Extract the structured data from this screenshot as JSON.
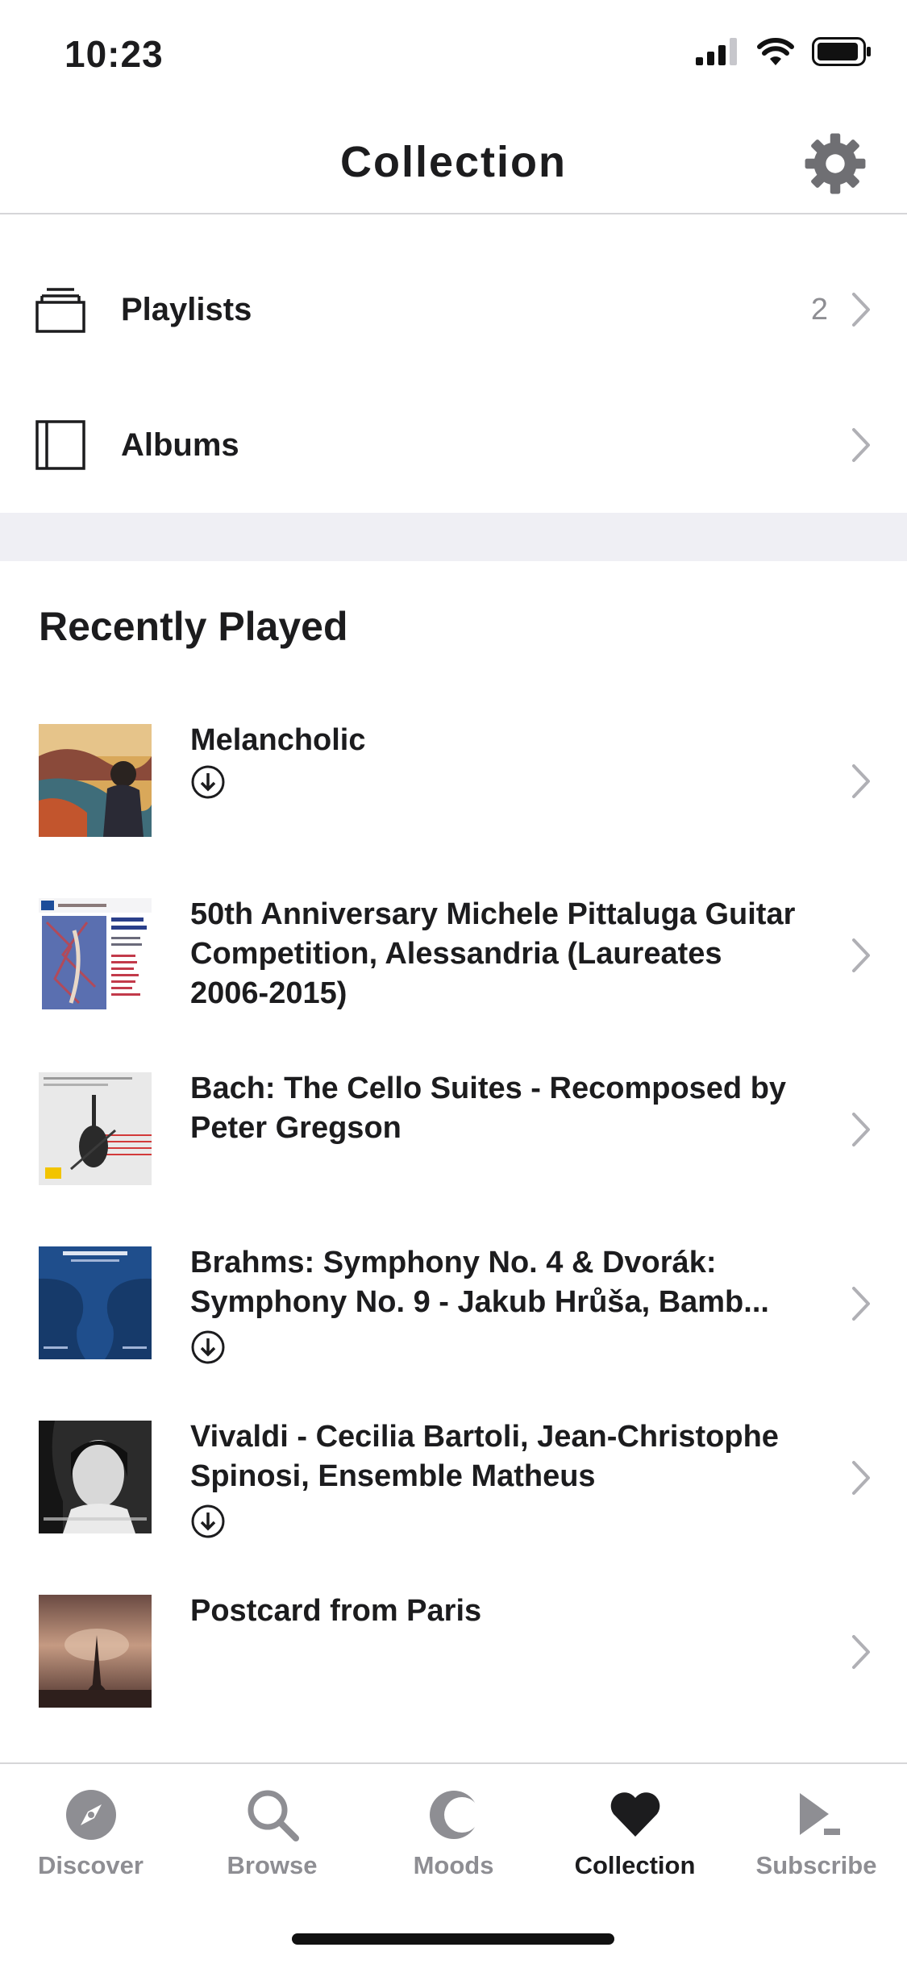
{
  "status_bar": {
    "time": "10:23"
  },
  "nav": {
    "title": "Collection"
  },
  "menu": {
    "playlists": {
      "label": "Playlists",
      "count": "2"
    },
    "albums": {
      "label": "Albums"
    }
  },
  "recently_played": {
    "title": "Recently Played",
    "items": [
      {
        "title": "Melancholic",
        "downloaded": true
      },
      {
        "title": "50th Anniversary Michele Pittaluga Guitar Competition, Alessandria (Laureates 2006-2015)",
        "downloaded": false
      },
      {
        "title": "Bach: The Cello Suites - Recomposed by Peter Gregson",
        "downloaded": false
      },
      {
        "title": "Brahms: Symphony No. 4 & Dvorák: Symphony No. 9 - Jakub Hrůša, Bamb...",
        "downloaded": true
      },
      {
        "title": "Vivaldi - Cecilia Bartoli, Jean-Christophe Spinosi, Ensemble Matheus",
        "downloaded": true
      },
      {
        "title": "Postcard from Paris",
        "downloaded": false
      }
    ]
  },
  "tabs": [
    {
      "label": "Discover",
      "icon": "compass-icon"
    },
    {
      "label": "Browse",
      "icon": "search-icon"
    },
    {
      "label": "Moods",
      "icon": "moon-icon"
    },
    {
      "label": "Collection",
      "icon": "heart-icon",
      "active": true
    },
    {
      "label": "Subscribe",
      "icon": "play-icon"
    }
  ],
  "colors": {
    "text": "#1c1c1e",
    "muted": "#8e8e93",
    "band": "#efeff4"
  }
}
